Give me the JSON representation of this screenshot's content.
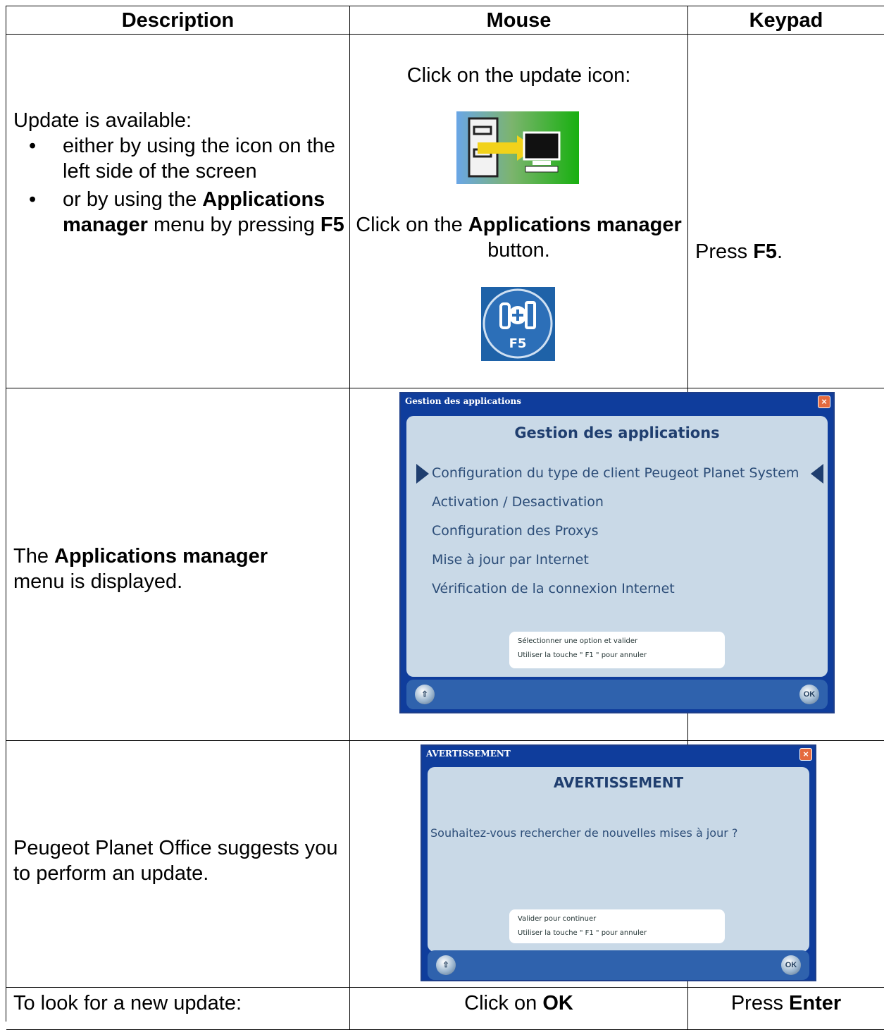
{
  "table": {
    "headers": [
      "Description",
      "Mouse",
      "Keypad"
    ],
    "row1": {
      "desc_intro": "Update is available:",
      "bullet1": "either by using the icon on the left side of the screen",
      "bullet2_pre": "or by using the ",
      "bullet2_bold": "Applications manager",
      "bullet2_mid": " menu by pressing ",
      "bullet2_key": "F5",
      "mouse_line1": "Click on the update icon:",
      "mouse_line2_pre": "Click on the ",
      "mouse_line2_bold": "Applications manager",
      "mouse_line2_post": " button.",
      "keypad_pre": "Press ",
      "keypad_key": "F5",
      "keypad_post": "."
    },
    "row2": {
      "desc_pre": "The ",
      "desc_bold": "Applications manager",
      "desc_post": " menu is displayed."
    },
    "row3": {
      "desc": "Peugeot Planet Office suggests you to perform an update."
    },
    "row4": {
      "desc": "To look for a new update:",
      "mouse_pre": "Click on ",
      "mouse_bold": "OK",
      "keypad_pre": "Press ",
      "keypad_bold": "Enter"
    }
  },
  "icons": {
    "f5_label": "F5"
  },
  "dialog_apps": {
    "window_title": "Gestion des applications",
    "heading": "Gestion des applications",
    "items": [
      "Configuration du type de client Peugeot Planet System",
      "Activation / Desactivation",
      "Configuration des Proxys",
      "Mise à jour par Internet",
      "Vérification de la connexion Internet"
    ],
    "hint_line1": "Sélectionner une option et valider",
    "hint_line2": "Utiliser la touche \" F1 \" pour annuler",
    "ok_label": "OK"
  },
  "dialog_warn": {
    "window_title": "AVERTISSEMENT",
    "heading": "AVERTISSEMENT",
    "question": "Souhaitez-vous rechercher de nouvelles mises à jour ?",
    "hint_line1": "Valider pour continuer",
    "hint_line2": "Utiliser la touche \" F1 \" pour annuler",
    "ok_label": "OK"
  }
}
